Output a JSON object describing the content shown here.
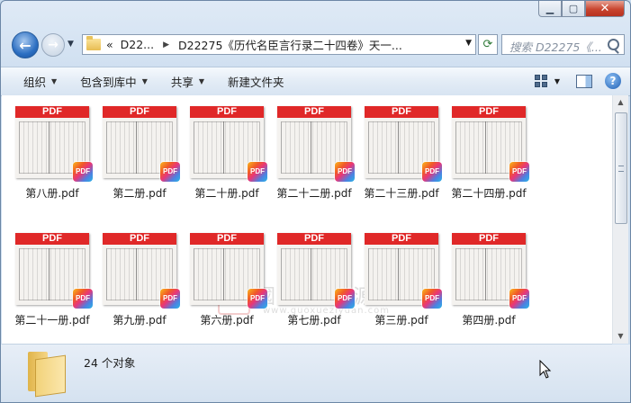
{
  "window": {
    "caption": {
      "minimize": "▁",
      "maximize": "▢",
      "close": "✕"
    }
  },
  "nav": {
    "back_symbol": "←",
    "forward_symbol": "→",
    "breadcrumb_overflow": "«",
    "breadcrumb_1": "D22...",
    "breadcrumb_2": "D22275《历代名臣言行录二十四卷》天一...",
    "refresh_symbol": "⟳",
    "search_placeholder": "搜索 D22275《..."
  },
  "toolbar": {
    "organize": "组织",
    "include_in_library": "包含到库中",
    "share": "共享",
    "new_folder": "新建文件夹",
    "help_symbol": "?"
  },
  "files": [
    {
      "name": "第八册.pdf"
    },
    {
      "name": "第二册.pdf"
    },
    {
      "name": "第二十册.pdf"
    },
    {
      "name": "第二十二册.pdf"
    },
    {
      "name": "第二十三册.pdf"
    },
    {
      "name": "第二十四册.pdf"
    },
    {
      "name": "第二十一册.pdf"
    },
    {
      "name": "第九册.pdf"
    },
    {
      "name": "第六册.pdf"
    },
    {
      "name": "第七册.pdf"
    },
    {
      "name": "第三册.pdf"
    },
    {
      "name": "第四册.pdf"
    }
  ],
  "thumb": {
    "banner": "PDF",
    "badge": "PDF"
  },
  "watermark": {
    "seal": "国",
    "text": "國學資源網",
    "url": "www.guoxueziyuan.com"
  },
  "status": {
    "count": "24 个对象"
  },
  "colors": {
    "pdf_banner": "#e02828",
    "window_frame": "#6c87a6",
    "toolbar_bg": "#dde8f4"
  }
}
